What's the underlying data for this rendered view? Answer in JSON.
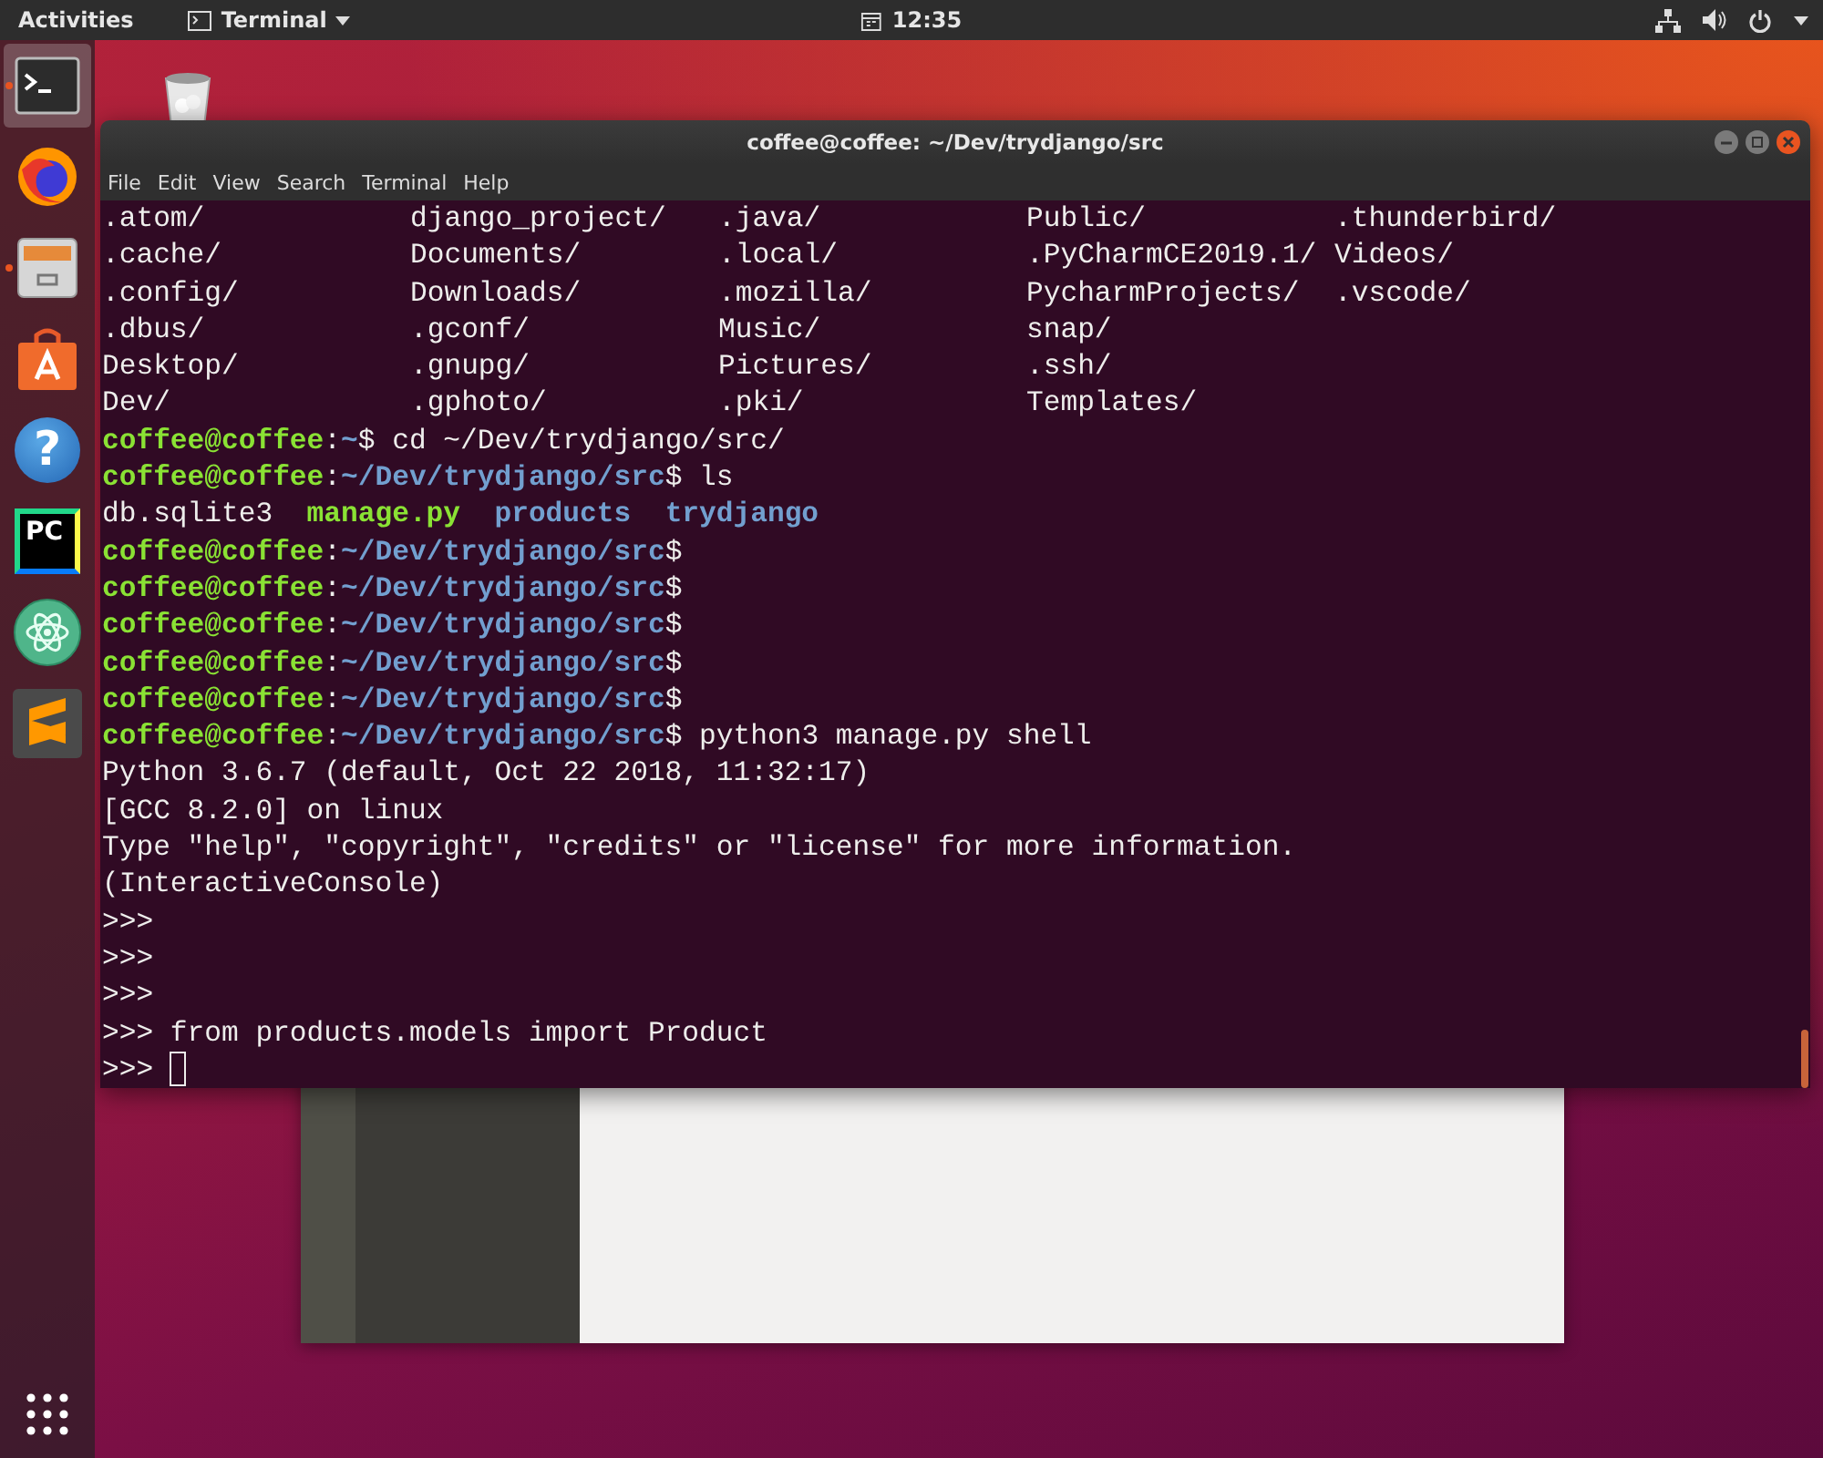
{
  "top_bar": {
    "activities": "Activities",
    "app_menu": "Terminal",
    "clock": "12:35"
  },
  "dock": {
    "items": [
      {
        "kind": "terminal",
        "selected": true,
        "running": true
      },
      {
        "kind": "firefox",
        "selected": false,
        "running": false
      },
      {
        "kind": "files",
        "selected": false,
        "running": true
      },
      {
        "kind": "software",
        "selected": false,
        "running": false
      },
      {
        "kind": "help",
        "selected": false,
        "running": false,
        "glyph": "?"
      },
      {
        "kind": "pycharm",
        "selected": false,
        "running": false,
        "glyph": "PC"
      },
      {
        "kind": "atom",
        "selected": false,
        "running": false
      },
      {
        "kind": "sublime",
        "selected": false,
        "running": false
      }
    ]
  },
  "terminal": {
    "title": "coffee@coffee: ~/Dev/trydjango/src",
    "menu": [
      "File",
      "Edit",
      "View",
      "Search",
      "Terminal",
      "Help"
    ],
    "listing": [
      [
        ".atom/",
        "django_project/",
        ".java/",
        "Public/",
        ".thunderbird/"
      ],
      [
        ".cache/",
        "Documents/",
        ".local/",
        ".PyCharmCE2019.1/",
        "Videos/"
      ],
      [
        ".config/",
        "Downloads/",
        ".mozilla/",
        "PycharmProjects/",
        ".vscode/"
      ],
      [
        ".dbus/",
        ".gconf/",
        "Music/",
        "snap/"
      ],
      [
        "Desktop/",
        ".gnupg/",
        "Pictures/",
        ".ssh/"
      ],
      [
        "Dev/",
        ".gphoto/",
        ".pki/",
        "Templates/"
      ]
    ],
    "lines": [
      {
        "segments": [
          {
            "text": "coffee@coffee",
            "kind": "user"
          },
          {
            "text": ":",
            "kind": "plain"
          },
          {
            "text": "~",
            "kind": "path"
          },
          {
            "text": "$ cd ~/Dev/trydjango/src/",
            "kind": "plain"
          }
        ]
      },
      {
        "segments": [
          {
            "text": "coffee@coffee",
            "kind": "user"
          },
          {
            "text": ":",
            "kind": "plain"
          },
          {
            "text": "~/Dev/trydjango/src",
            "kind": "path"
          },
          {
            "text": "$ ls",
            "kind": "plain"
          }
        ]
      },
      {
        "segments": [
          {
            "text": "db.sqlite3  ",
            "kind": "plain"
          },
          {
            "text": "manage.py  ",
            "kind": "exec"
          },
          {
            "text": "products  ",
            "kind": "dir"
          },
          {
            "text": "trydjango",
            "kind": "dir"
          }
        ]
      },
      {
        "segments": [
          {
            "text": "coffee@coffee",
            "kind": "user"
          },
          {
            "text": ":",
            "kind": "plain"
          },
          {
            "text": "~/Dev/trydjango/src",
            "kind": "path"
          },
          {
            "text": "$",
            "kind": "plain"
          }
        ]
      },
      {
        "segments": [
          {
            "text": "coffee@coffee",
            "kind": "user"
          },
          {
            "text": ":",
            "kind": "plain"
          },
          {
            "text": "~/Dev/trydjango/src",
            "kind": "path"
          },
          {
            "text": "$",
            "kind": "plain"
          }
        ]
      },
      {
        "segments": [
          {
            "text": "coffee@coffee",
            "kind": "user"
          },
          {
            "text": ":",
            "kind": "plain"
          },
          {
            "text": "~/Dev/trydjango/src",
            "kind": "path"
          },
          {
            "text": "$",
            "kind": "plain"
          }
        ]
      },
      {
        "segments": [
          {
            "text": "coffee@coffee",
            "kind": "user"
          },
          {
            "text": ":",
            "kind": "plain"
          },
          {
            "text": "~/Dev/trydjango/src",
            "kind": "path"
          },
          {
            "text": "$",
            "kind": "plain"
          }
        ]
      },
      {
        "segments": [
          {
            "text": "coffee@coffee",
            "kind": "user"
          },
          {
            "text": ":",
            "kind": "plain"
          },
          {
            "text": "~/Dev/trydjango/src",
            "kind": "path"
          },
          {
            "text": "$",
            "kind": "plain"
          }
        ]
      },
      {
        "segments": [
          {
            "text": "coffee@coffee",
            "kind": "user"
          },
          {
            "text": ":",
            "kind": "plain"
          },
          {
            "text": "~/Dev/trydjango/src",
            "kind": "path"
          },
          {
            "text": "$ python3 manage.py shell",
            "kind": "plain"
          }
        ]
      },
      {
        "segments": [
          {
            "text": "Python 3.6.7 (default, Oct 22 2018, 11:32:17)",
            "kind": "plain"
          }
        ]
      },
      {
        "segments": [
          {
            "text": "[GCC 8.2.0] on linux",
            "kind": "plain"
          }
        ]
      },
      {
        "segments": [
          {
            "text": "Type \"help\", \"copyright\", \"credits\" or \"license\" for more information.",
            "kind": "plain"
          }
        ]
      },
      {
        "segments": [
          {
            "text": "(InteractiveConsole)",
            "kind": "plain"
          }
        ]
      },
      {
        "segments": [
          {
            "text": ">>>",
            "kind": "plain"
          }
        ]
      },
      {
        "segments": [
          {
            "text": ">>>",
            "kind": "plain"
          }
        ]
      },
      {
        "segments": [
          {
            "text": ">>>",
            "kind": "plain"
          }
        ]
      },
      {
        "segments": [
          {
            "text": ">>> from products.models import Product",
            "kind": "plain"
          }
        ]
      },
      {
        "segments": [
          {
            "text": ">>>",
            "kind": "plain"
          }
        ],
        "cursor": true
      }
    ]
  }
}
